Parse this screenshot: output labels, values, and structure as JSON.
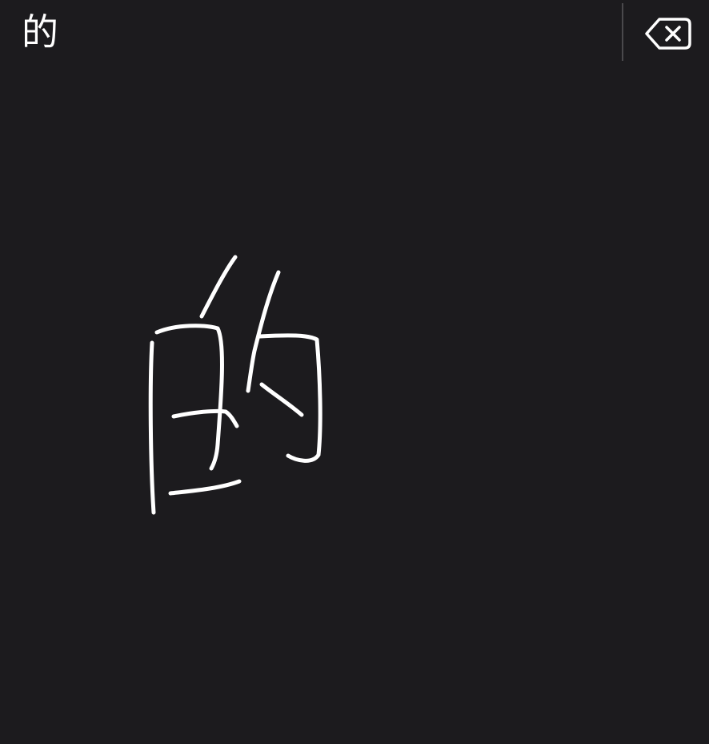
{
  "keyboard": {
    "mode": "handwriting",
    "candidates": [
      {
        "char": "的"
      }
    ],
    "delete_icon": "delete-backspace-icon",
    "colors": {
      "background": "#1c1b1e",
      "ink": "#ffffff",
      "divider": "#4a494c"
    }
  }
}
